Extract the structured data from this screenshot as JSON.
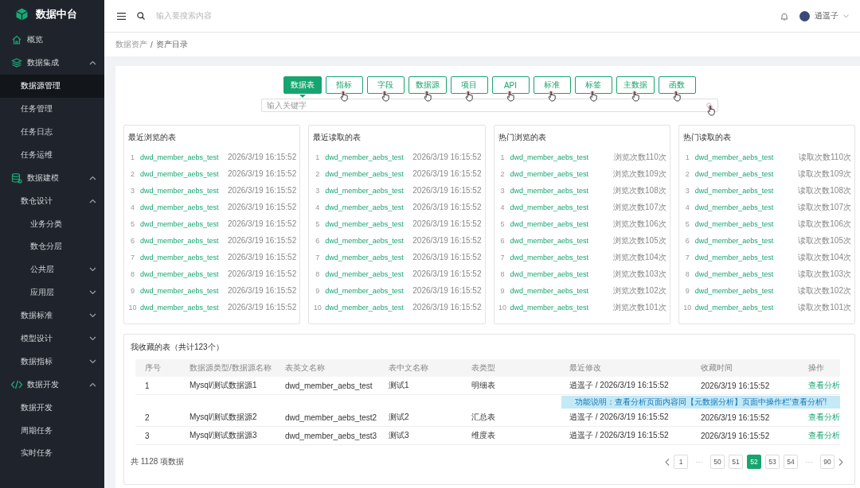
{
  "sidebar": {
    "title": "数据中台",
    "items": [
      {
        "label": "概览",
        "selected": false
      },
      {
        "label": "数据集成",
        "expanded": true,
        "selected": false,
        "children": [
          {
            "label": "数据源管理",
            "selected": true
          },
          {
            "label": "任务管理",
            "selected": false
          },
          {
            "label": "任务日志",
            "selected": false
          },
          {
            "label": "任务运维",
            "selected": false
          }
        ]
      },
      {
        "label": "数据建模",
        "expanded": true,
        "selected": false,
        "children": [
          {
            "label": "数仓设计",
            "expanded": true,
            "selected": false,
            "children": [
              {
                "label": "业务分类",
                "selected": false
              },
              {
                "label": "数仓分层",
                "selected": false
              },
              {
                "label": "公共层",
                "expanded": false,
                "selected": false
              },
              {
                "label": "应用层",
                "expanded": false,
                "selected": false
              }
            ]
          },
          {
            "label": "数据标准",
            "expanded": false,
            "selected": false
          },
          {
            "label": "模型设计",
            "expanded": false,
            "selected": false
          },
          {
            "label": "数据指标",
            "expanded": false,
            "selected": false
          }
        ]
      },
      {
        "label": "数据开发",
        "expanded": true,
        "selected": false,
        "children": [
          {
            "label": "数据开发",
            "selected": false
          },
          {
            "label": "周期任务",
            "selected": false
          },
          {
            "label": "实时任务",
            "selected": false
          }
        ]
      }
    ]
  },
  "header": {
    "search_placeholder": "输入要搜索内容",
    "user": "逍遥子"
  },
  "breadcrumb": {
    "items": [
      "数据资产",
      "资产目录"
    ],
    "separator": "/"
  },
  "tabs": [
    {
      "label": "数据表",
      "selected": true,
      "pointer": false
    },
    {
      "label": "指标",
      "selected": false,
      "pointer": true
    },
    {
      "label": "字段",
      "selected": false,
      "pointer": true
    },
    {
      "label": "数据源",
      "selected": false,
      "pointer": true
    },
    {
      "label": "项目",
      "selected": false,
      "pointer": true
    },
    {
      "label": "API",
      "selected": false,
      "pointer": true
    },
    {
      "label": "标准",
      "selected": false,
      "pointer": true
    },
    {
      "label": "标签",
      "selected": false,
      "pointer": true
    },
    {
      "label": "主数据",
      "selected": false,
      "pointer": true
    },
    {
      "label": "函数",
      "selected": false,
      "pointer": true
    }
  ],
  "keyword_search": {
    "placeholder": "输入关键字",
    "pointer": true
  },
  "panels": [
    {
      "title": "最近浏览的表",
      "rows": [
        {
          "index": "1",
          "name": "dwd_member_aebs_test",
          "info": "2026/3/19 16:15:52"
        },
        {
          "index": "2",
          "name": "dwd_member_aebs_test",
          "info": "2026/3/19 16:15:52"
        },
        {
          "index": "3",
          "name": "dwd_member_aebs_test",
          "info": "2026/3/19 16:15:52"
        },
        {
          "index": "4",
          "name": "dwd_member_aebs_test",
          "info": "2026/3/19 16:15:52"
        },
        {
          "index": "5",
          "name": "dwd_member_aebs_test",
          "info": "2026/3/19 16:15:52"
        },
        {
          "index": "6",
          "name": "dwd_member_aebs_test",
          "info": "2026/3/19 16:15:52"
        },
        {
          "index": "7",
          "name": "dwd_member_aebs_test",
          "info": "2026/3/19 16:15:52"
        },
        {
          "index": "8",
          "name": "dwd_member_aebs_test",
          "info": "2026/3/19 16:15:52"
        },
        {
          "index": "9",
          "name": "dwd_member_aebs_test",
          "info": "2026/3/19 16:15:52"
        },
        {
          "index": "10",
          "name": "dwd_member_aebs_test",
          "info": "2026/3/19 16:15:52"
        }
      ]
    },
    {
      "title": "最近读取的表",
      "rows": [
        {
          "index": "1",
          "name": "dwd_member_aebs_test",
          "info": "2026/3/19 16:15:52"
        },
        {
          "index": "2",
          "name": "dwd_member_aebs_test",
          "info": "2026/3/19 16:15:52"
        },
        {
          "index": "3",
          "name": "dwd_member_aebs_test",
          "info": "2026/3/19 16:15:52"
        },
        {
          "index": "4",
          "name": "dwd_member_aebs_test",
          "info": "2026/3/19 16:15:52"
        },
        {
          "index": "5",
          "name": "dwd_member_aebs_test",
          "info": "2026/3/19 16:15:52"
        },
        {
          "index": "6",
          "name": "dwd_member_aebs_test",
          "info": "2026/3/19 16:15:52"
        },
        {
          "index": "7",
          "name": "dwd_member_aebs_test",
          "info": "2026/3/19 16:15:52"
        },
        {
          "index": "8",
          "name": "dwd_member_aebs_test",
          "info": "2026/3/19 16:15:52"
        },
        {
          "index": "9",
          "name": "dwd_member_aebs_test",
          "info": "2026/3/19 16:15:52"
        },
        {
          "index": "10",
          "name": "dwd_member_aebs_test",
          "info": "2026/3/19 16:15:52"
        }
      ]
    },
    {
      "title": "热门浏览的表",
      "rows": [
        {
          "index": "1",
          "name": "dwd_member_aebs_test",
          "info": "浏览次数110次"
        },
        {
          "index": "2",
          "name": "dwd_member_aebs_test",
          "info": "浏览次数109次"
        },
        {
          "index": "3",
          "name": "dwd_member_aebs_test",
          "info": "浏览次数108次"
        },
        {
          "index": "4",
          "name": "dwd_member_aebs_test",
          "info": "浏览次数107次"
        },
        {
          "index": "5",
          "name": "dwd_member_aebs_test",
          "info": "浏览次数106次"
        },
        {
          "index": "6",
          "name": "dwd_member_aebs_test",
          "info": "浏览次数105次"
        },
        {
          "index": "7",
          "name": "dwd_member_aebs_test",
          "info": "浏览次数104次"
        },
        {
          "index": "8",
          "name": "dwd_member_aebs_test",
          "info": "浏览次数103次"
        },
        {
          "index": "9",
          "name": "dwd_member_aebs_test",
          "info": "浏览次数102次"
        },
        {
          "index": "10",
          "name": "dwd_member_aebs_test",
          "info": "浏览次数101次"
        }
      ]
    },
    {
      "title": "热门读取的表",
      "rows": [
        {
          "index": "1",
          "name": "dwd_member_aebs_test",
          "info": "读取次数110次"
        },
        {
          "index": "2",
          "name": "dwd_member_aebs_test",
          "info": "读取次数109次"
        },
        {
          "index": "3",
          "name": "dwd_member_aebs_test",
          "info": "读取次数108次"
        },
        {
          "index": "4",
          "name": "dwd_member_aebs_test",
          "info": "读取次数107次"
        },
        {
          "index": "5",
          "name": "dwd_member_aebs_test",
          "info": "读取次数106次"
        },
        {
          "index": "6",
          "name": "dwd_member_aebs_test",
          "info": "读取次数105次"
        },
        {
          "index": "7",
          "name": "dwd_member_aebs_test",
          "info": "读取次数104次"
        },
        {
          "index": "8",
          "name": "dwd_member_aebs_test",
          "info": "读取次数103次"
        },
        {
          "index": "9",
          "name": "dwd_member_aebs_test",
          "info": "读取次数102次"
        },
        {
          "index": "10",
          "name": "dwd_member_aebs_test",
          "info": "读取次数101次"
        }
      ]
    }
  ],
  "favorites": {
    "title": "我收藏的表（共计123个）",
    "columns": [
      "序号",
      "数据源类型/数据源名称",
      "表英文名称",
      "表中文名称",
      "表类型",
      "最近修改",
      "收藏时间",
      "操作"
    ],
    "rows": [
      [
        "1",
        "Mysql/测试数据源1",
        "dwd_member_aebs_test",
        "测试1",
        "明细表",
        "逍遥子 / 2026/3/19 16:15:52",
        "2026/3/19 16:15:52",
        "查看分析"
      ],
      [
        "2",
        "Mysql/测试数据源2",
        "dwd_member_aebs_test2",
        "测试2",
        "汇总表",
        "逍遥子 / 2026/3/19 16:15:52",
        "2026/3/19 16:15:52",
        "查看分析"
      ],
      [
        "3",
        "Mysql/测试数据源3",
        "dwd_member_aebs_test3",
        "测试3",
        "维度表",
        "逍遥子 / 2026/3/19 16:15:52",
        "2026/3/19 16:15:52",
        "查看分析"
      ]
    ],
    "tooltip": "功能说明：查看分析页面内容同【元数据分析】页面中操作栏'查看分析'!",
    "total": "共 1128 项数据",
    "pages": [
      {
        "kind": "page",
        "label": "1",
        "selected": false
      },
      {
        "kind": "ellipsis",
        "label": "···"
      },
      {
        "kind": "page",
        "label": "50",
        "selected": false
      },
      {
        "kind": "page",
        "label": "51",
        "selected": false
      },
      {
        "kind": "page",
        "label": "52",
        "selected": true
      },
      {
        "kind": "page",
        "label": "53",
        "selected": false
      },
      {
        "kind": "page",
        "label": "54",
        "selected": false
      },
      {
        "kind": "ellipsis",
        "label": "···"
      },
      {
        "kind": "page",
        "label": "90",
        "selected": false
      }
    ]
  }
}
